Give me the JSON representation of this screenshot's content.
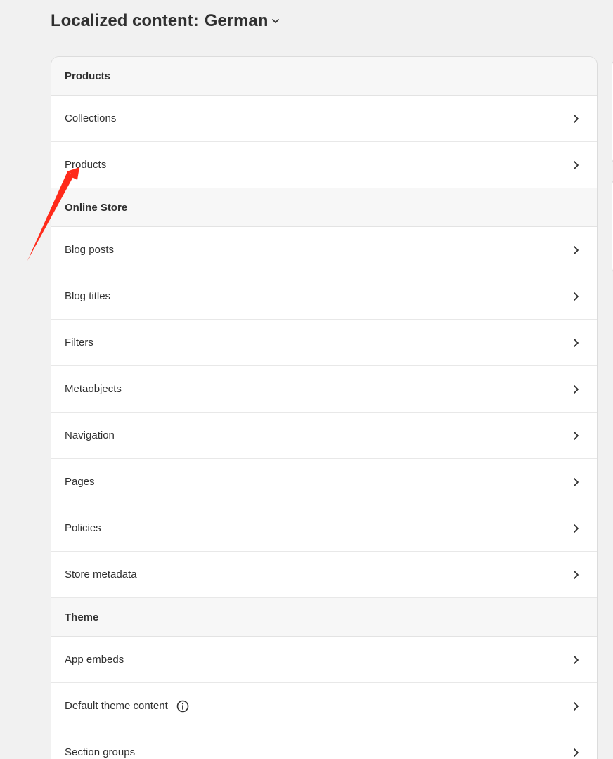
{
  "header": {
    "title": "Localized content:",
    "language": "German",
    "language_icon": "chevron-down-icon"
  },
  "sections": [
    {
      "title": "Products",
      "items": [
        {
          "label": "Collections"
        },
        {
          "label": "Products"
        }
      ]
    },
    {
      "title": "Online Store",
      "items": [
        {
          "label": "Blog posts"
        },
        {
          "label": "Blog titles"
        },
        {
          "label": "Filters"
        },
        {
          "label": "Metaobjects"
        },
        {
          "label": "Navigation"
        },
        {
          "label": "Pages"
        },
        {
          "label": "Policies"
        },
        {
          "label": "Store metadata"
        }
      ]
    },
    {
      "title": "Theme",
      "items": [
        {
          "label": "App embeds"
        },
        {
          "label": "Default theme content",
          "icon": "info-icon"
        },
        {
          "label": "Section groups"
        }
      ]
    }
  ],
  "colors": {
    "annotation_arrow": "#ff2a1a",
    "background": "#f1f1f1",
    "card": "#ffffff",
    "section_header": "#f7f7f7"
  }
}
